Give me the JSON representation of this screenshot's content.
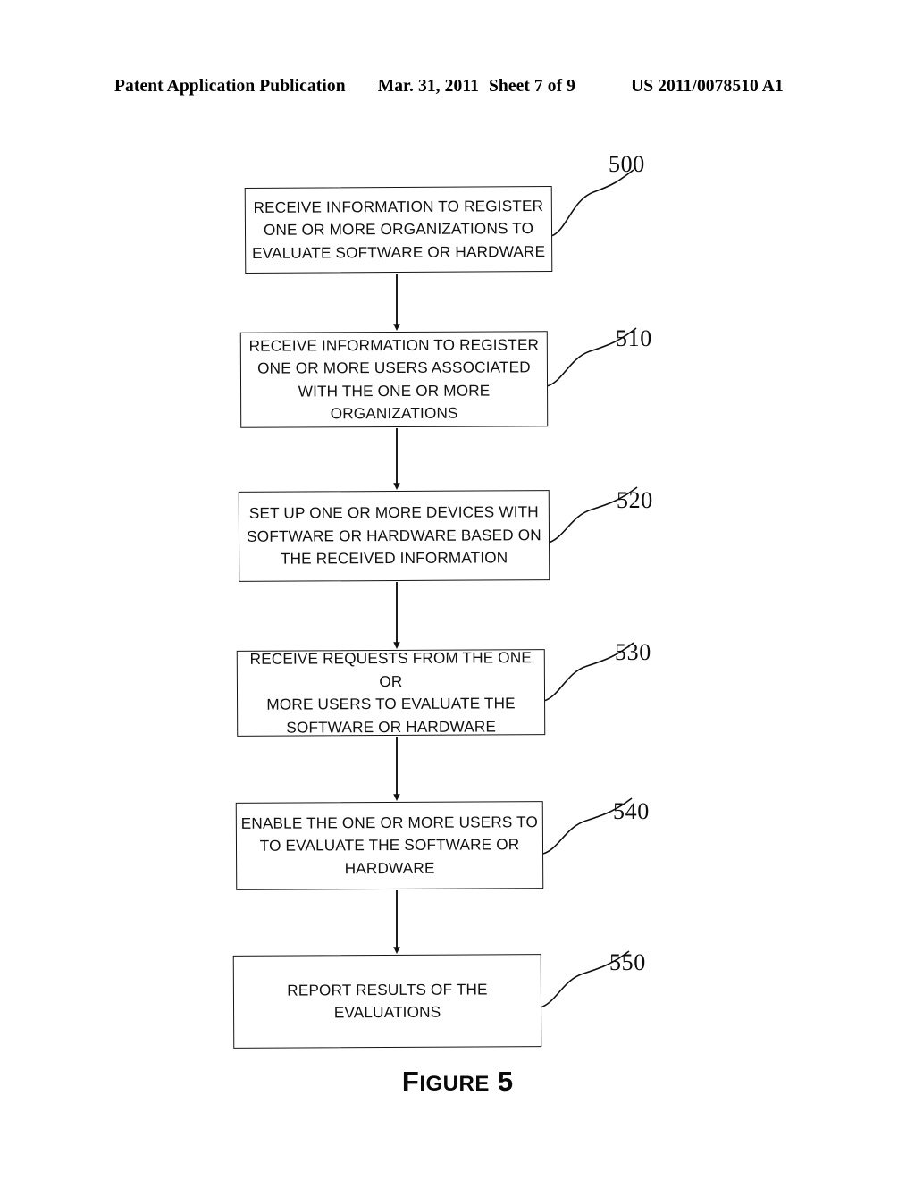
{
  "header": {
    "publication": "Patent Application Publication",
    "date": "Mar. 31, 2011",
    "sheet": "Sheet 7 of 9",
    "patent_number": "US 2011/0078510 A1"
  },
  "figure": {
    "caption_lead": "F",
    "caption_rest": "IGURE",
    "caption_number": "5"
  },
  "diagram": {
    "type": "flowchart",
    "orientation": "vertical",
    "ink_color": "#111111",
    "background": "#ffffff",
    "nodes": [
      {
        "ref": "500",
        "text": "RECEIVE INFORMATION TO REGISTER\nONE OR MORE ORGANIZATIONS TO\nEVALUATE SOFTWARE OR HARDWARE"
      },
      {
        "ref": "510",
        "text": "RECEIVE INFORMATION TO REGISTER\nONE OR MORE USERS ASSOCIATED\nWITH THE ONE OR MORE\nORGANIZATIONS"
      },
      {
        "ref": "520",
        "text": "SET UP ONE OR MORE DEVICES WITH\nSOFTWARE OR HARDWARE BASED ON\nTHE RECEIVED INFORMATION"
      },
      {
        "ref": "530",
        "text": "RECEIVE REQUESTS FROM THE ONE OR\nMORE USERS TO EVALUATE THE\nSOFTWARE OR HARDWARE"
      },
      {
        "ref": "540",
        "text": "ENABLE THE ONE OR MORE USERS TO\nTO EVALUATE THE SOFTWARE OR\nHARDWARE"
      },
      {
        "ref": "550",
        "text": "REPORT RESULTS OF THE\nEVALUATIONS"
      }
    ],
    "connectors": [
      {
        "from": "500",
        "to": "510",
        "style": "arrow-down"
      },
      {
        "from": "510",
        "to": "520",
        "style": "arrow-down"
      },
      {
        "from": "520",
        "to": "530",
        "style": "arrow-down"
      },
      {
        "from": "530",
        "to": "540",
        "style": "arrow-down"
      },
      {
        "from": "540",
        "to": "550",
        "style": "arrow-down"
      }
    ]
  }
}
